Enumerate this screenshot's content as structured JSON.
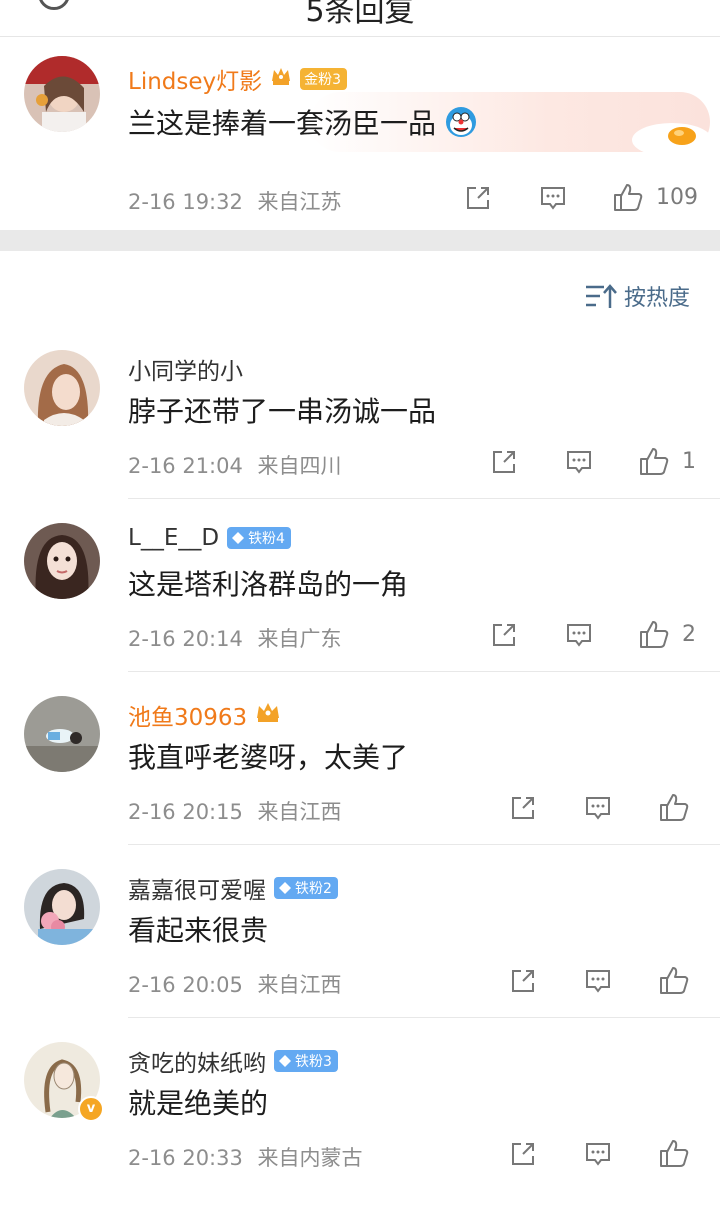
{
  "header": {
    "title": "5条回复"
  },
  "pinned": {
    "username": "Lindsey灯影",
    "fan_badge": "金粉3",
    "text": "兰这是捧着一套汤臣一品",
    "time": "2-16 19:32",
    "location": "来自江苏",
    "likes": "109"
  },
  "sort": {
    "label": "按热度"
  },
  "comments": [
    {
      "username": "小同学的小",
      "text": "脖子还带了一串汤诚一品",
      "time": "2-16 21:04",
      "location": "来自四川",
      "likes": "1"
    },
    {
      "username": "L__E__D",
      "fan_badge": "铁粉4",
      "text": "这是塔利洛群岛的一角",
      "time": "2-16 20:14",
      "location": "来自广东",
      "likes": "2"
    },
    {
      "username": "池鱼30963",
      "text": "我直呼老婆呀，太美了",
      "time": "2-16 20:15",
      "location": "来自江西",
      "likes": ""
    },
    {
      "username": "嘉嘉很可爱喔",
      "fan_badge": "铁粉2",
      "text": "看起来很贵",
      "time": "2-16 20:05",
      "location": "来自江西",
      "likes": ""
    },
    {
      "username": "贪吃的妹纸哟",
      "fan_badge": "铁粉3",
      "text": "就是绝美的",
      "time": "2-16 20:33",
      "location": "来自内蒙古",
      "likes": ""
    }
  ],
  "colors": {
    "vip_name": "#f07a1a",
    "fan_badge": "#63a9f2",
    "gold_badge": "#f5b334",
    "sort_text": "#4a6b8a",
    "section_gap": "#e9e9e9"
  },
  "icons": [
    "share-icon",
    "comment-icon",
    "like-icon",
    "sort-icon",
    "crown-icon",
    "diamond-icon",
    "verified-icon"
  ]
}
